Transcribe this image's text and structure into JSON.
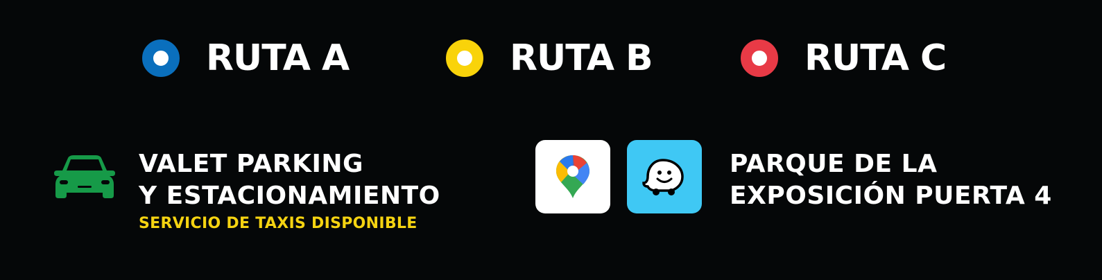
{
  "routes": [
    {
      "label": "RUTA A",
      "color": "#0a6fbd"
    },
    {
      "label": "RUTA B",
      "color": "#f9d30a"
    },
    {
      "label": "RUTA C",
      "color": "#e83a46"
    }
  ],
  "parking": {
    "icon": "car-icon",
    "icon_color": "#169a48",
    "line1": "VALET PARKING",
    "line2": "Y ESTACIONAMIENTO",
    "note": "SERVICIO DE TAXIS DISPONIBLE",
    "note_color": "#f5d311"
  },
  "apps": [
    {
      "icon": "google-maps-icon",
      "tile_color": "#ffffff"
    },
    {
      "icon": "waze-icon",
      "tile_color": "#3fc8f4"
    }
  ],
  "venue": {
    "line1": "PARQUE DE LA",
    "line2": "EXPOSICIÓN PUERTA 4"
  }
}
